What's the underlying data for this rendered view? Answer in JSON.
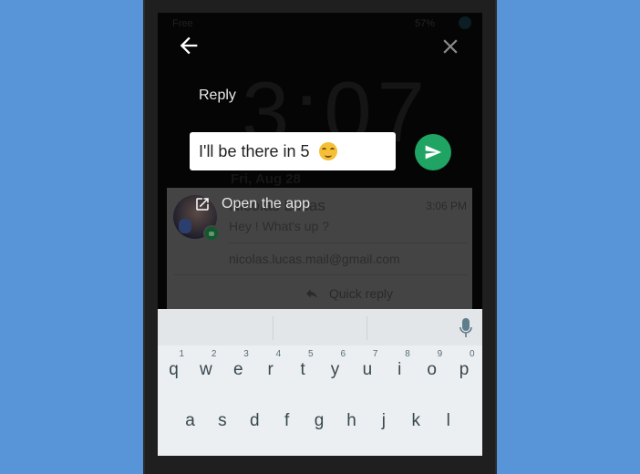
{
  "status_bar": {
    "carrier": "Free",
    "battery": "57%"
  },
  "lockscreen": {
    "clock": "3:07",
    "date": "Fri, Aug 28"
  },
  "overlay": {
    "reply_label": "Reply",
    "reply_input_value": "I'll be there in 5",
    "reply_emoji": "smiling-face-icon",
    "open_app_label": "Open the app",
    "send_color": "#1fa463"
  },
  "notification": {
    "sender": "Nicolas Lucas",
    "time": "3:06 PM",
    "message": "Hey ! What's up ?",
    "email": "nicolas.lucas.mail@gmail.com",
    "quick_reply_label": "Quick reply"
  },
  "keyboard": {
    "row1": [
      {
        "ch": "q",
        "num": "1"
      },
      {
        "ch": "w",
        "num": "2"
      },
      {
        "ch": "e",
        "num": "3"
      },
      {
        "ch": "r",
        "num": "4"
      },
      {
        "ch": "t",
        "num": "5"
      },
      {
        "ch": "y",
        "num": "6"
      },
      {
        "ch": "u",
        "num": "7"
      },
      {
        "ch": "i",
        "num": "8"
      },
      {
        "ch": "o",
        "num": "9"
      },
      {
        "ch": "p",
        "num": "0"
      }
    ],
    "row2": [
      {
        "ch": "a"
      },
      {
        "ch": "s"
      },
      {
        "ch": "d"
      },
      {
        "ch": "f"
      },
      {
        "ch": "g"
      },
      {
        "ch": "h"
      },
      {
        "ch": "j"
      },
      {
        "ch": "k"
      },
      {
        "ch": "l"
      }
    ]
  }
}
